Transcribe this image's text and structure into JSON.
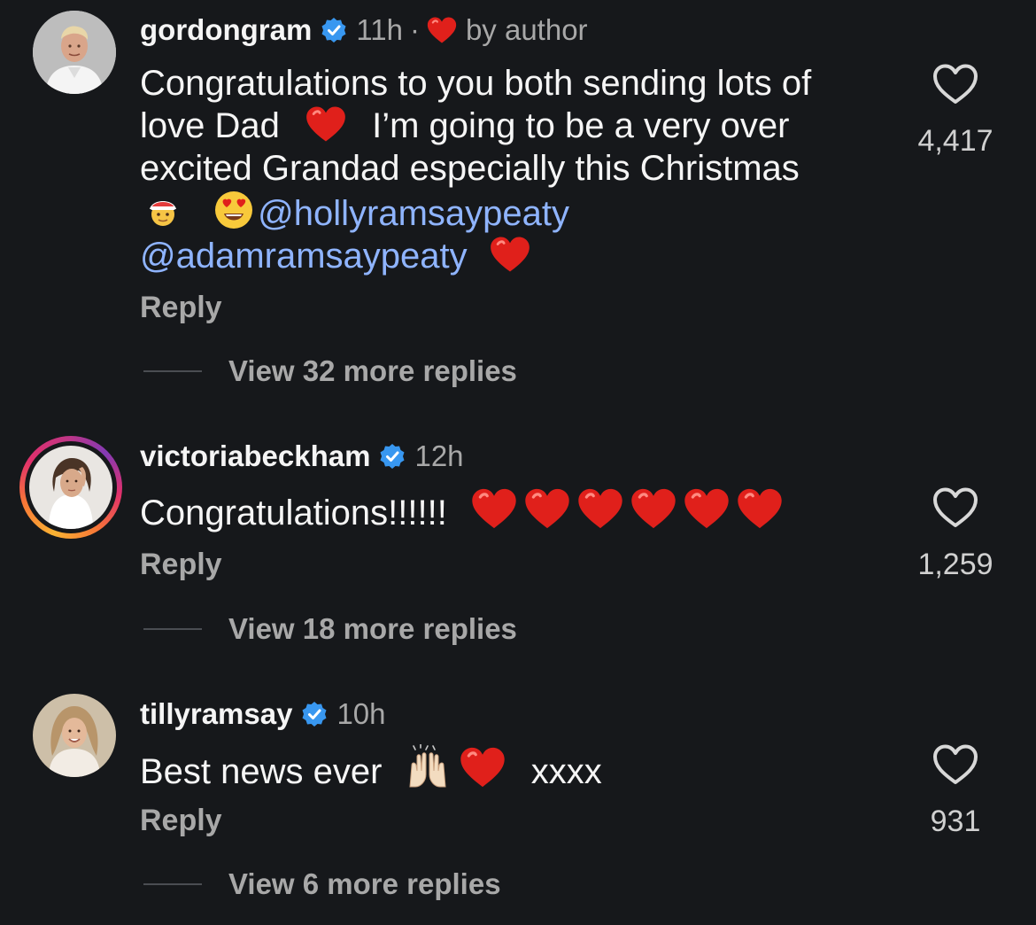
{
  "comments": [
    {
      "username": "gordongram",
      "time": "11h",
      "separator": "·",
      "by_author": "by author",
      "text_line1": "Congratulations to you both sending lots of",
      "text_line2a": "love Dad",
      "text_line2b": "I’m going to be a very over",
      "text_line3": "excited Grandad especially this Christmas",
      "mention1": "@hollyramsaypeaty",
      "mention2": "@adamramsaypeaty",
      "reply_label": "Reply",
      "view_replies": "View 32 more replies",
      "likes": "4,417"
    },
    {
      "username": "victoriabeckham",
      "time": "12h",
      "text": "Congratulations!!!!!!",
      "reply_label": "Reply",
      "view_replies": "View 18 more replies",
      "likes": "1,259"
    },
    {
      "username": "tillyramsay",
      "time": "10h",
      "text_a": "Best news ever",
      "text_b": "xxxx",
      "reply_label": "Reply",
      "view_replies": "View 6 more replies",
      "likes": "931"
    }
  ],
  "icons": {
    "verified": "verified-badge-icon",
    "like": "heart-outline-icon",
    "heart_emoji": "red-heart-emoji"
  },
  "colors": {
    "background": "#16181b",
    "mention": "#8fb4ff",
    "verified": "#3897f0",
    "heart": "#e0201b",
    "muted": "#a8a8a8"
  }
}
